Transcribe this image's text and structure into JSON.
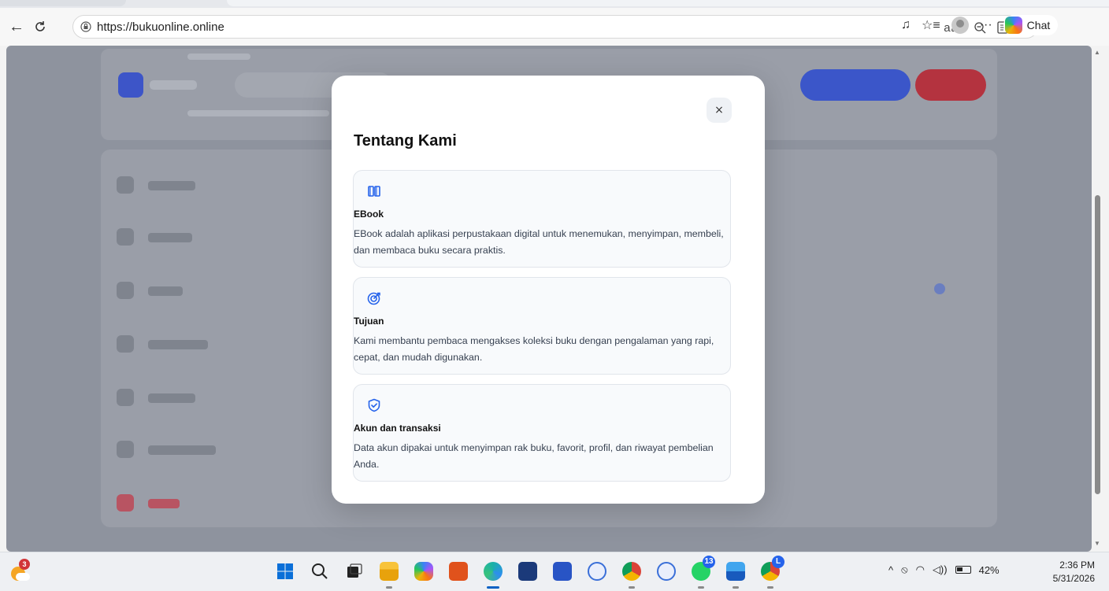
{
  "browser": {
    "url": "https://bukuonline.online",
    "chat_label": "Chat"
  },
  "modal": {
    "title": "Tentang Kami",
    "close_glyph": "×",
    "cards": [
      {
        "icon": "books-icon",
        "title": "EBook",
        "text": "EBook adalah aplikasi perpustakaan digital untuk menemukan, menyimpan, membeli, dan membaca buku secara praktis."
      },
      {
        "icon": "target-icon",
        "title": "Tujuan",
        "text": "Kami membantu pembaca mengakses koleksi buku dengan pengalaman yang rapi, cepat, dan mudah digunakan."
      },
      {
        "icon": "shield-check-icon",
        "title": "Akun dan transaksi",
        "text": "Data akun dipakai untuk menyimpan rak buku, favorit, profil, dan riwayat pembelian Anda."
      }
    ]
  },
  "taskbar": {
    "weather_badge": "3",
    "whatsapp_badge": "13",
    "profile_badge": "L",
    "battery": "42%",
    "time": "2:36 PM",
    "date": "5/31/2026"
  },
  "colors": {
    "accent": "#2563eb",
    "overlay": "#8e939e",
    "danger": "#b4333f"
  }
}
